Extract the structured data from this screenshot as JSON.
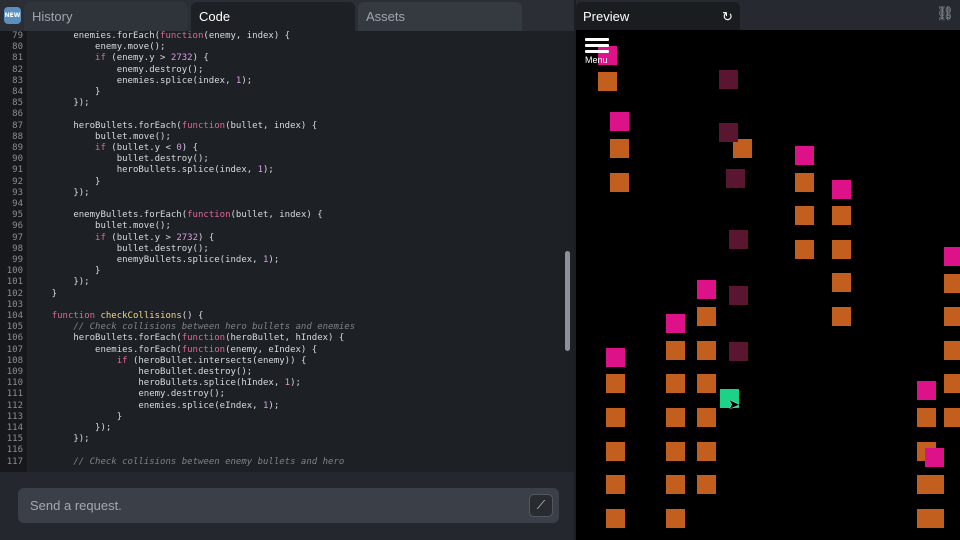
{
  "tabs": [
    {
      "label": "History"
    },
    {
      "label": "Code"
    },
    {
      "label": "Assets"
    }
  ],
  "app_icon_label": "NEW",
  "code_lines": [
    {
      "n": "79",
      "html": "        enemies.forEach(<span class=\"kw\">function</span>(enemy, index) {"
    },
    {
      "n": "80",
      "html": "            enemy.move();"
    },
    {
      "n": "81",
      "html": "            <span class=\"kw\">if</span> (enemy.y &gt; <span class=\"num\">2732</span>) {"
    },
    {
      "n": "82",
      "html": "                enemy.destroy();"
    },
    {
      "n": "83",
      "html": "                enemies.splice(index, <span class=\"num\">1</span>);"
    },
    {
      "n": "84",
      "html": "            }"
    },
    {
      "n": "85",
      "html": "        });"
    },
    {
      "n": "86",
      "html": ""
    },
    {
      "n": "87",
      "html": "        heroBullets.forEach(<span class=\"kw\">function</span>(bullet, index) {"
    },
    {
      "n": "88",
      "html": "            bullet.move();"
    },
    {
      "n": "89",
      "html": "            <span class=\"kw\">if</span> (bullet.y &lt; <span class=\"num\">0</span>) {"
    },
    {
      "n": "90",
      "html": "                bullet.destroy();"
    },
    {
      "n": "91",
      "html": "                heroBullets.splice(index, <span class=\"num\">1</span>);"
    },
    {
      "n": "92",
      "html": "            }"
    },
    {
      "n": "93",
      "html": "        });"
    },
    {
      "n": "94",
      "html": ""
    },
    {
      "n": "95",
      "html": "        enemyBullets.forEach(<span class=\"kw\">function</span>(bullet, index) {"
    },
    {
      "n": "96",
      "html": "            bullet.move();"
    },
    {
      "n": "97",
      "html": "            <span class=\"kw\">if</span> (bullet.y &gt; <span class=\"num\">2732</span>) {"
    },
    {
      "n": "98",
      "html": "                bullet.destroy();"
    },
    {
      "n": "99",
      "html": "                enemyBullets.splice(index, <span class=\"num\">1</span>);"
    },
    {
      "n": "100",
      "html": "            }"
    },
    {
      "n": "101",
      "html": "        });"
    },
    {
      "n": "102",
      "html": "    }"
    },
    {
      "n": "103",
      "html": ""
    },
    {
      "n": "104",
      "html": "    <span class=\"kw\">function</span> <span class=\"fn\">checkCollisions</span>() {"
    },
    {
      "n": "105",
      "html": "        <span class=\"cm\">// Check collisions between hero bullets and enemies</span>"
    },
    {
      "n": "106",
      "html": "        heroBullets.forEach(<span class=\"kw\">function</span>(heroBullet, hIndex) {"
    },
    {
      "n": "107",
      "html": "            enemies.forEach(<span class=\"kw\">function</span>(enemy, eIndex) {"
    },
    {
      "n": "108",
      "html": "                <span class=\"kw\">if</span> (heroBullet.intersects(enemy)) {"
    },
    {
      "n": "109",
      "html": "                    heroBullet.destroy();"
    },
    {
      "n": "110",
      "html": "                    heroBullets.splice(hIndex, <span class=\"num\">1</span>);"
    },
    {
      "n": "111",
      "html": "                    enemy.destroy();"
    },
    {
      "n": "112",
      "html": "                    enemies.splice(eIndex, <span class=\"num\">1</span>);"
    },
    {
      "n": "113",
      "html": "                }"
    },
    {
      "n": "114",
      "html": "            });"
    },
    {
      "n": "115",
      "html": "        });"
    },
    {
      "n": "116",
      "html": ""
    },
    {
      "n": "117",
      "html": "        <span class=\"cm\">// Check collisions between enemy bullets and hero</span>"
    }
  ],
  "request": {
    "placeholder": "Send a request."
  },
  "preview": {
    "tab_label": "Preview",
    "menu_label": "Menu"
  },
  "colors": {
    "orange": "#c25f1e",
    "pink": "#dd1288",
    "maroon": "#5a1631",
    "green": "#1bd287"
  },
  "icons": {
    "refresh": "refresh-icon",
    "link": "link-icon",
    "wand": "magic-wand-icon",
    "menu": "menu-icon"
  }
}
